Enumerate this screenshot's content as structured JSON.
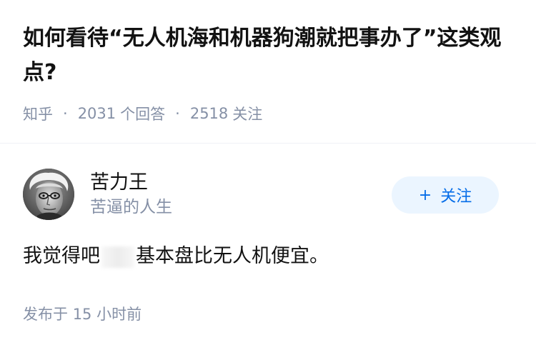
{
  "question": {
    "title": "如何看待“无人机海和机器狗潮就把事办了”这类观点?",
    "meta": {
      "source": "知乎",
      "answers_count": "2031",
      "answers_label": "个回答",
      "followers_count": "2518",
      "followers_label": "关注"
    }
  },
  "answer": {
    "author": {
      "name": "苦力王",
      "bio": "苦逼的人生",
      "avatar_icon": "portrait-avatar"
    },
    "follow_button": {
      "icon": "plus-icon",
      "plus_glyph": "+",
      "label": "关注"
    },
    "content_before": "我觉得吧",
    "content_after": "基本盘比无人机便宜。",
    "published_label": "发布于",
    "published_value": "15 小时前"
  },
  "colors": {
    "text_primary": "#121212",
    "text_secondary": "#8590a6",
    "brand_blue": "#056de8",
    "follow_bg": "#ebf5ff"
  }
}
